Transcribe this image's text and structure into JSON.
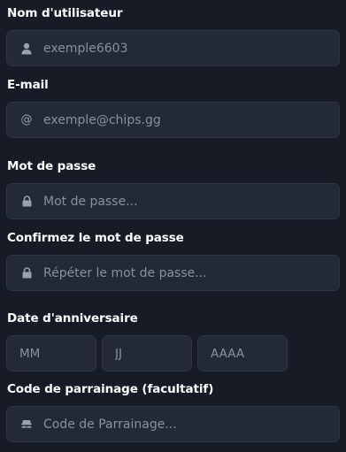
{
  "form": {
    "username": {
      "label": "Nom d'utilisateur",
      "placeholder": "exemple6603",
      "icon": "user-icon"
    },
    "email": {
      "label": "E-mail",
      "placeholder": "exemple@chips.gg",
      "icon": "at-icon",
      "icon_glyph": "@"
    },
    "password": {
      "label": "Mot de passe",
      "placeholder": "Mot de passe...",
      "icon": "lock-icon"
    },
    "confirm_password": {
      "label": "Confirmez le mot de passe",
      "placeholder": "Répéter le mot de passe...",
      "icon": "lock-icon"
    },
    "birthday": {
      "label": "Date d'anniversaire",
      "month_placeholder": "MM",
      "day_placeholder": "JJ",
      "year_placeholder": "AAAA"
    },
    "referral": {
      "label": "Code de parrainage (facultatif)",
      "placeholder": "Code de Parrainage...",
      "icon": "mustache-disguise-icon"
    }
  },
  "colors": {
    "background": "#161b26",
    "field_background": "#232937",
    "field_border": "#2e3545",
    "label_text": "#ffffff",
    "placeholder_text": "#8a909c",
    "icon": "#9aa1ae"
  }
}
